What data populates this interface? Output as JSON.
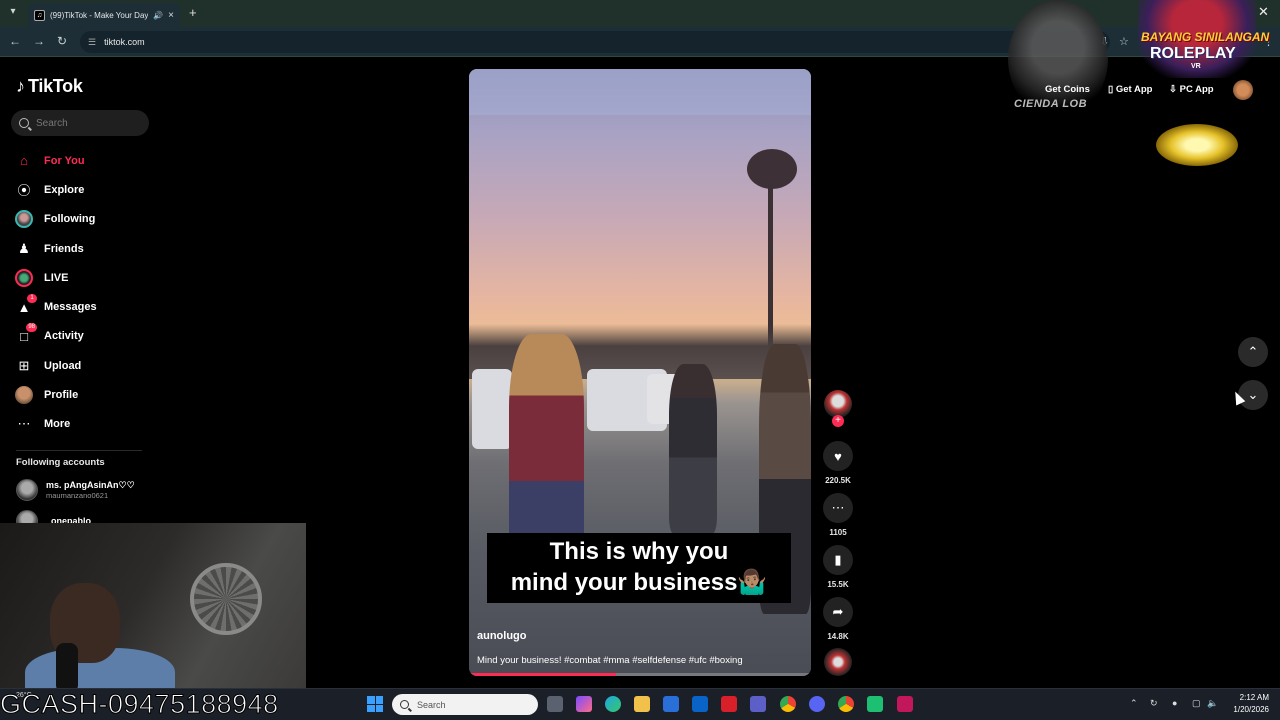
{
  "browser": {
    "tab_title": "(99)TikTok - Make Your Day",
    "url": "tiktok.com"
  },
  "sidebar": {
    "logo": "TikTok",
    "search_placeholder": "Search",
    "items": [
      {
        "label": "For You",
        "icon": "home-icon",
        "active": true
      },
      {
        "label": "Explore",
        "icon": "compass-icon"
      },
      {
        "label": "Following",
        "icon": "following-avatar-icon"
      },
      {
        "label": "Friends",
        "icon": "friends-icon"
      },
      {
        "label": "LIVE",
        "icon": "live-icon"
      },
      {
        "label": "Messages",
        "icon": "messages-icon",
        "badge": "1"
      },
      {
        "label": "Activity",
        "icon": "activity-icon",
        "badge": "98"
      },
      {
        "label": "Upload",
        "icon": "upload-icon"
      },
      {
        "label": "Profile",
        "icon": "profile-avatar-icon"
      },
      {
        "label": "More",
        "icon": "more-icon"
      }
    ],
    "following_heading": "Following accounts",
    "accounts": [
      {
        "name": "ms. pAngAsinAn♡♡",
        "handle": "maumanzano0621"
      },
      {
        "name": "_onepablo",
        "handle": ""
      }
    ]
  },
  "header": {
    "coins": "Get Coins",
    "get_app": "Get App",
    "pc_app": "PC App"
  },
  "overlays": {
    "emblem_text": "CIENDA LOB",
    "brand_line1": "BAYANG SINILANGAN",
    "brand_line2": "ROLEPLAY",
    "brand_line3": "VR",
    "watermark": "GCASH-09475188948"
  },
  "video": {
    "caption_line1": "This is why you",
    "caption_line2": "mind your business🤷🏽‍♂️",
    "author": "aunolugo",
    "description": "Mind your business! #combat #mma #selfdefense #ufc  #boxing",
    "progress": 0.43,
    "likes": "220.5K",
    "comments": "1105",
    "saves": "15.5K",
    "shares": "14.8K"
  },
  "taskbar": {
    "search_placeholder": "Search",
    "weather": "26°C",
    "time": "2:12 AM",
    "date": "1/20/2026"
  }
}
